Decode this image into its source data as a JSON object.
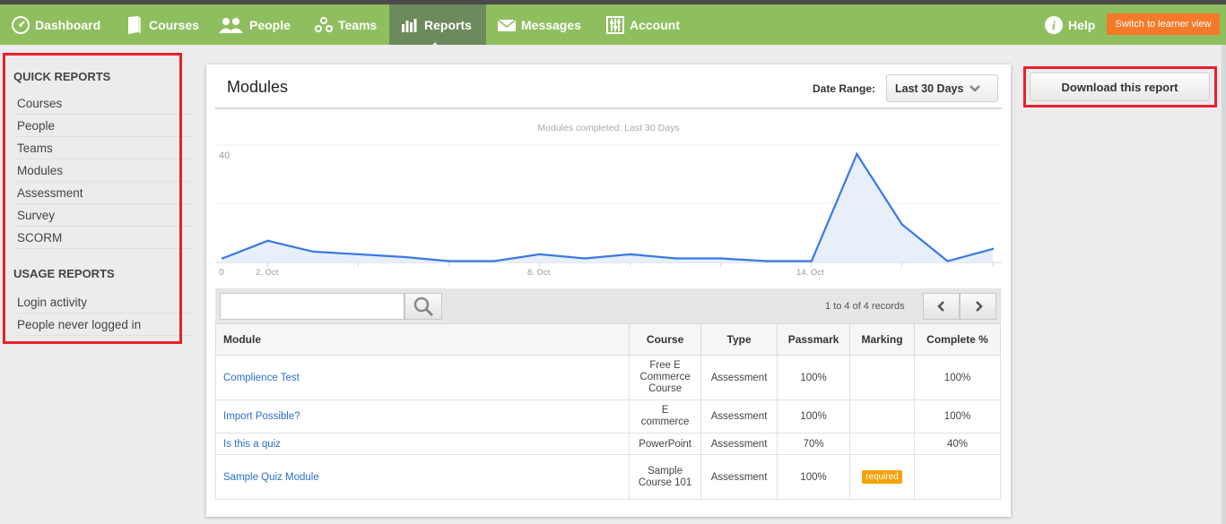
{
  "nav": {
    "items": [
      {
        "label": "Dashboard",
        "icon": "dashboard-icon"
      },
      {
        "label": "Courses",
        "icon": "book-icon"
      },
      {
        "label": "People",
        "icon": "people-icon"
      },
      {
        "label": "Teams",
        "icon": "teams-icon"
      },
      {
        "label": "Reports",
        "icon": "bar-chart-icon",
        "active": true
      },
      {
        "label": "Messages",
        "icon": "envelope-icon"
      },
      {
        "label": "Account",
        "icon": "sliders-icon"
      }
    ],
    "help_label": "Help",
    "learner_label": "Switch to learner view"
  },
  "sidebar": {
    "quick_heading": "QUICK REPORTS",
    "quick_items": [
      "Courses",
      "People",
      "Teams",
      "Modules",
      "Assessment",
      "Survey",
      "SCORM"
    ],
    "usage_heading": "USAGE REPORTS",
    "usage_items": [
      "Login activity",
      "People never logged in"
    ]
  },
  "panel": {
    "title": "Modules",
    "date_range_label": "Date Range:",
    "date_range_value": "Last 30 Days"
  },
  "chart_data": {
    "type": "area",
    "title": "Modules completed: Last 30 Days",
    "x_tick_labels": [
      "2. Oct",
      "8. Oct",
      "14. Oct"
    ],
    "y_tick_labels": [
      "0",
      "40"
    ],
    "ylim": [
      0,
      40
    ],
    "values": [
      1.5,
      8,
      4,
      3,
      2,
      0.5,
      0.5,
      3,
      1.5,
      3,
      1.5,
      1.5,
      0.5,
      0.5,
      40,
      14,
      0.5,
      5
    ],
    "colors": {
      "line": "#3b78e7",
      "fill": "#e6effa"
    },
    "grid": true
  },
  "table_toolbar": {
    "search_placeholder": "",
    "records_text": "1 to 4 of 4 records"
  },
  "table": {
    "columns": [
      "Module",
      "Course",
      "Type",
      "Passmark",
      "Marking",
      "Complete %"
    ],
    "rows": [
      {
        "module": "Complience Test",
        "course": "Free E Commerce Course",
        "type": "Assessment",
        "passmark": "100%",
        "marking": "",
        "complete": "100%"
      },
      {
        "module": "Import Possible?",
        "course": "E commerce",
        "type": "Assessment",
        "passmark": "100%",
        "marking": "",
        "complete": "100%"
      },
      {
        "module": "Is this a quiz",
        "course": "PowerPoint",
        "type": "Assessment",
        "passmark": "70%",
        "marking": "",
        "complete": "40%"
      },
      {
        "module": "Sample Quiz Module",
        "course": "Sample Course 101",
        "type": "Assessment",
        "passmark": "100%",
        "marking": "required",
        "complete": ""
      }
    ]
  },
  "download_label": "Download this report",
  "colors": {
    "nav_bg": "#8fbe5f",
    "nav_active": "#6d8a5c",
    "learner_btn": "#f47a2a",
    "link": "#2a6fc9",
    "badge": "#f5a10a",
    "highlight": "#e8202e"
  }
}
